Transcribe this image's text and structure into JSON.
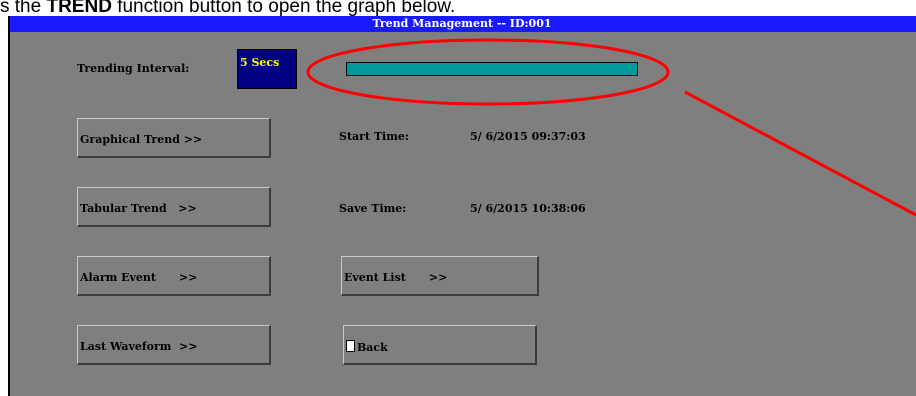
{
  "caption": {
    "prefix": "s the ",
    "bold": "TREND",
    "suffix": " function button to open the graph below."
  },
  "window": {
    "title": "Trend Management -- ID:001"
  },
  "interval": {
    "label": "Trending Interval:",
    "value": "5 Secs"
  },
  "progress": {
    "fraction": 1.0,
    "color": "#009a9a"
  },
  "buttons": {
    "graphical_trend": "Graphical Trend >>",
    "tabular_trend": "Tabular Trend   >>",
    "alarm_event": "Alarm Event      >>",
    "last_waveform": "Last Waveform  >>",
    "event_list": "Event List      >>",
    "back": "Back"
  },
  "times": {
    "start_label": "Start Time:",
    "start_value": "5/ 6/2015  09:37:03",
    "save_label": "Save Time:",
    "save_value": "5/ 6/2015  10:38:06"
  },
  "colors": {
    "title_bar": "#1a1aff",
    "screen_bg": "#7f7f7f",
    "annotation": "#ff0000"
  }
}
